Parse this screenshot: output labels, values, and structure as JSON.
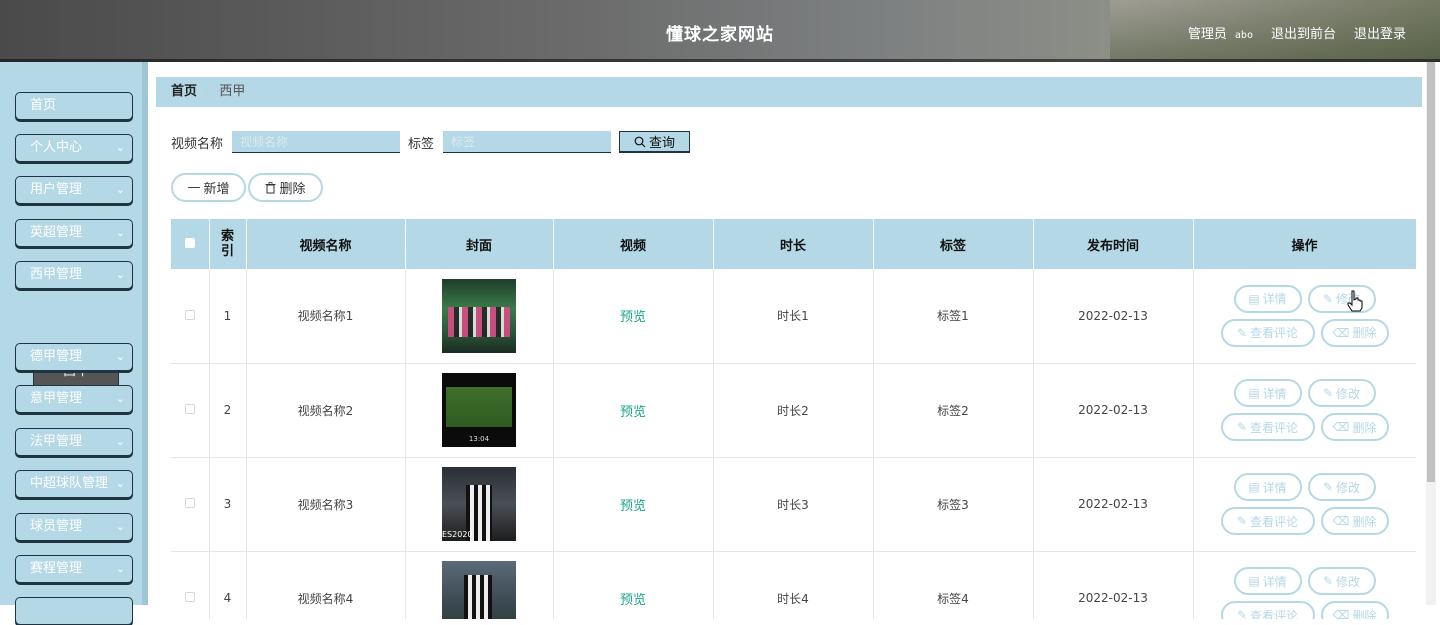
{
  "header": {
    "title": "懂球之家网站",
    "role_label": "管理员",
    "username": "abo",
    "to_front": "退出到前台",
    "logout": "退出登录"
  },
  "sidebar": {
    "items": [
      {
        "label": "首页",
        "has_children": false
      },
      {
        "label": "个人中心",
        "has_children": true
      },
      {
        "label": "用户管理",
        "has_children": true
      },
      {
        "label": "英超管理",
        "has_children": true
      },
      {
        "label": "西甲管理",
        "has_children": true
      },
      {
        "label": "德甲管理",
        "has_children": true
      },
      {
        "label": "意甲管理",
        "has_children": true
      },
      {
        "label": "法甲管理",
        "has_children": true
      },
      {
        "label": "中超球队管理",
        "has_children": true
      },
      {
        "label": "球员管理",
        "has_children": true
      },
      {
        "label": "赛程管理",
        "has_children": true
      }
    ],
    "submenu_active": "西甲"
  },
  "breadcrumb": {
    "home": "首页",
    "current": "西甲"
  },
  "search": {
    "name_label": "视频名称",
    "name_placeholder": "视频名称",
    "tag_label": "标签",
    "tag_placeholder": "标签",
    "query_label": "查询"
  },
  "actions": {
    "add_label": "新增",
    "delete_label": "删除"
  },
  "table": {
    "headers": [
      "索引",
      "视频名称",
      "封面",
      "视频",
      "时长",
      "标签",
      "发布时间",
      "操作"
    ],
    "rows": [
      {
        "index": "1",
        "name": "视频名称1",
        "video": "预览",
        "duration": "时长1",
        "tag": "标签1",
        "date": "2022-02-13"
      },
      {
        "index": "2",
        "name": "视频名称2",
        "video": "预览",
        "duration": "时长2",
        "tag": "标签2",
        "date": "2022-02-13"
      },
      {
        "index": "3",
        "name": "视频名称3",
        "video": "预览",
        "duration": "时长3",
        "tag": "标签3",
        "date": "2022-02-13"
      },
      {
        "index": "4",
        "name": "视频名称4",
        "video": "预览",
        "duration": "时长4",
        "tag": "标签4",
        "date": "2022-02-13"
      }
    ],
    "op_labels": {
      "detail": "详情",
      "edit": "修改",
      "comments": "查看评论",
      "delete": "删除"
    }
  },
  "colors": {
    "accent": "#b4d8e6",
    "border_dark": "#1e3440",
    "preview_link": "#19a58a"
  }
}
